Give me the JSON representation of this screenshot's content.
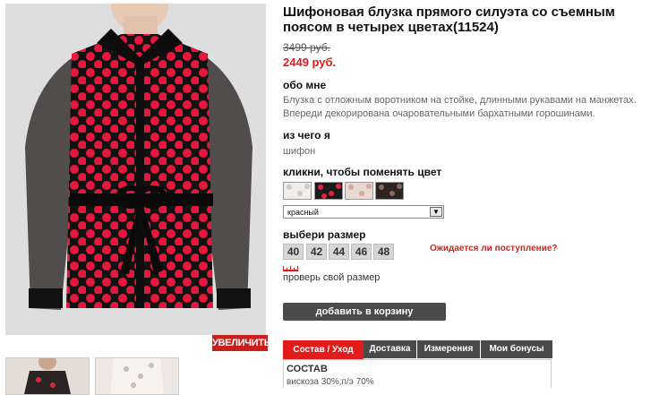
{
  "product": {
    "title": "Шифоновая блузка прямого силуэта со съемным поясом в четырех цветах(11524)",
    "old_price": "3499 руб.",
    "new_price": "2449 руб."
  },
  "about": {
    "heading": "обо мне",
    "text": "Блузка с отложным воротником на стойке, длинными рукавами на манжетах. Впереди декорирована очаровательными бархатными горошинами."
  },
  "material": {
    "heading": "из чего я",
    "text": "шифон"
  },
  "color": {
    "heading": "кликни, чтобы поменять цвет",
    "swatches": [
      {
        "name": "white",
        "base": "#f0eeec",
        "dot": "#cfcac6"
      },
      {
        "name": "red",
        "base": "#1a1a1a",
        "dot": "#e0233a"
      },
      {
        "name": "beige",
        "base": "#e8d9d3",
        "dot": "#d8a8a0"
      },
      {
        "name": "black",
        "base": "#2c2420",
        "dot": "#8a6a5a"
      }
    ],
    "selected": "красный",
    "arrow": "▼"
  },
  "size": {
    "heading": "выбери размер",
    "options": [
      "40",
      "42",
      "44",
      "46",
      "48"
    ],
    "waiting_link": "Ожидается ли поступление?",
    "check_link": "проверь свой размер"
  },
  "actions": {
    "zoom": "УВЕЛИЧИТЬ",
    "add_to_cart": "добавить в корзину"
  },
  "tabs": [
    {
      "label": "Состав / Уход",
      "active": true
    },
    {
      "label": "Доставка",
      "active": false
    },
    {
      "label": "Измерения",
      "active": false
    },
    {
      "label": "Мои бонусы",
      "active": false
    }
  ],
  "composition": {
    "heading": "СОСТАВ",
    "text": "вискоза 30%;п/э 70%"
  },
  "colors": {
    "accent": "#e21b1b",
    "button_dark": "#4a4a4a"
  }
}
